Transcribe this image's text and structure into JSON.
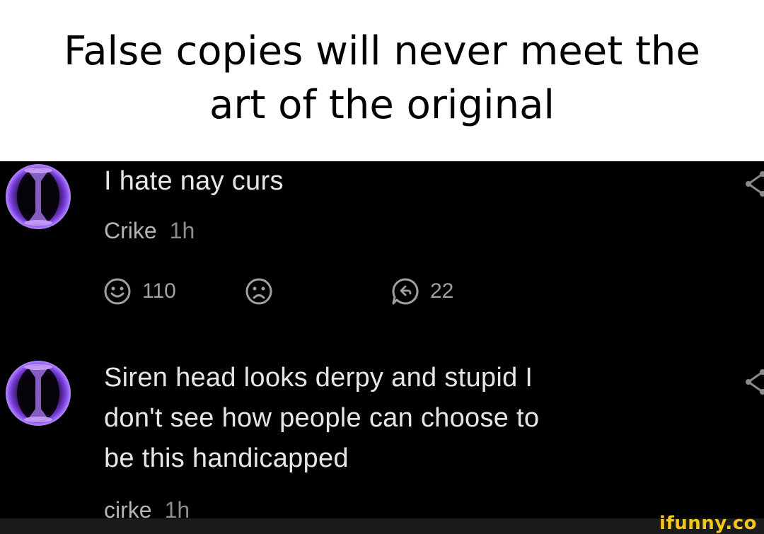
{
  "caption": {
    "line1": "False copies will never meet the",
    "line2": "art of the original"
  },
  "comments": [
    {
      "text": "I hate nay curs",
      "author": "Crike",
      "time": "1h",
      "likes": "110",
      "replies": "22"
    },
    {
      "text_lines": [
        "Siren head looks derpy and stupid I",
        "don't see how people can choose to",
        "be this handicapped"
      ],
      "author": "cirke",
      "time": "1h"
    }
  ],
  "icons": {
    "avatar": "purple-portal-avatar-icon",
    "like": "smile-face-icon",
    "dislike": "frown-face-icon",
    "reply": "reply-icon",
    "share": "share-icon"
  },
  "colors": {
    "background": "#000000",
    "avatar_accent": "#9b5cff",
    "watermark": "#f4c51b"
  },
  "watermark": "ifunny.co"
}
